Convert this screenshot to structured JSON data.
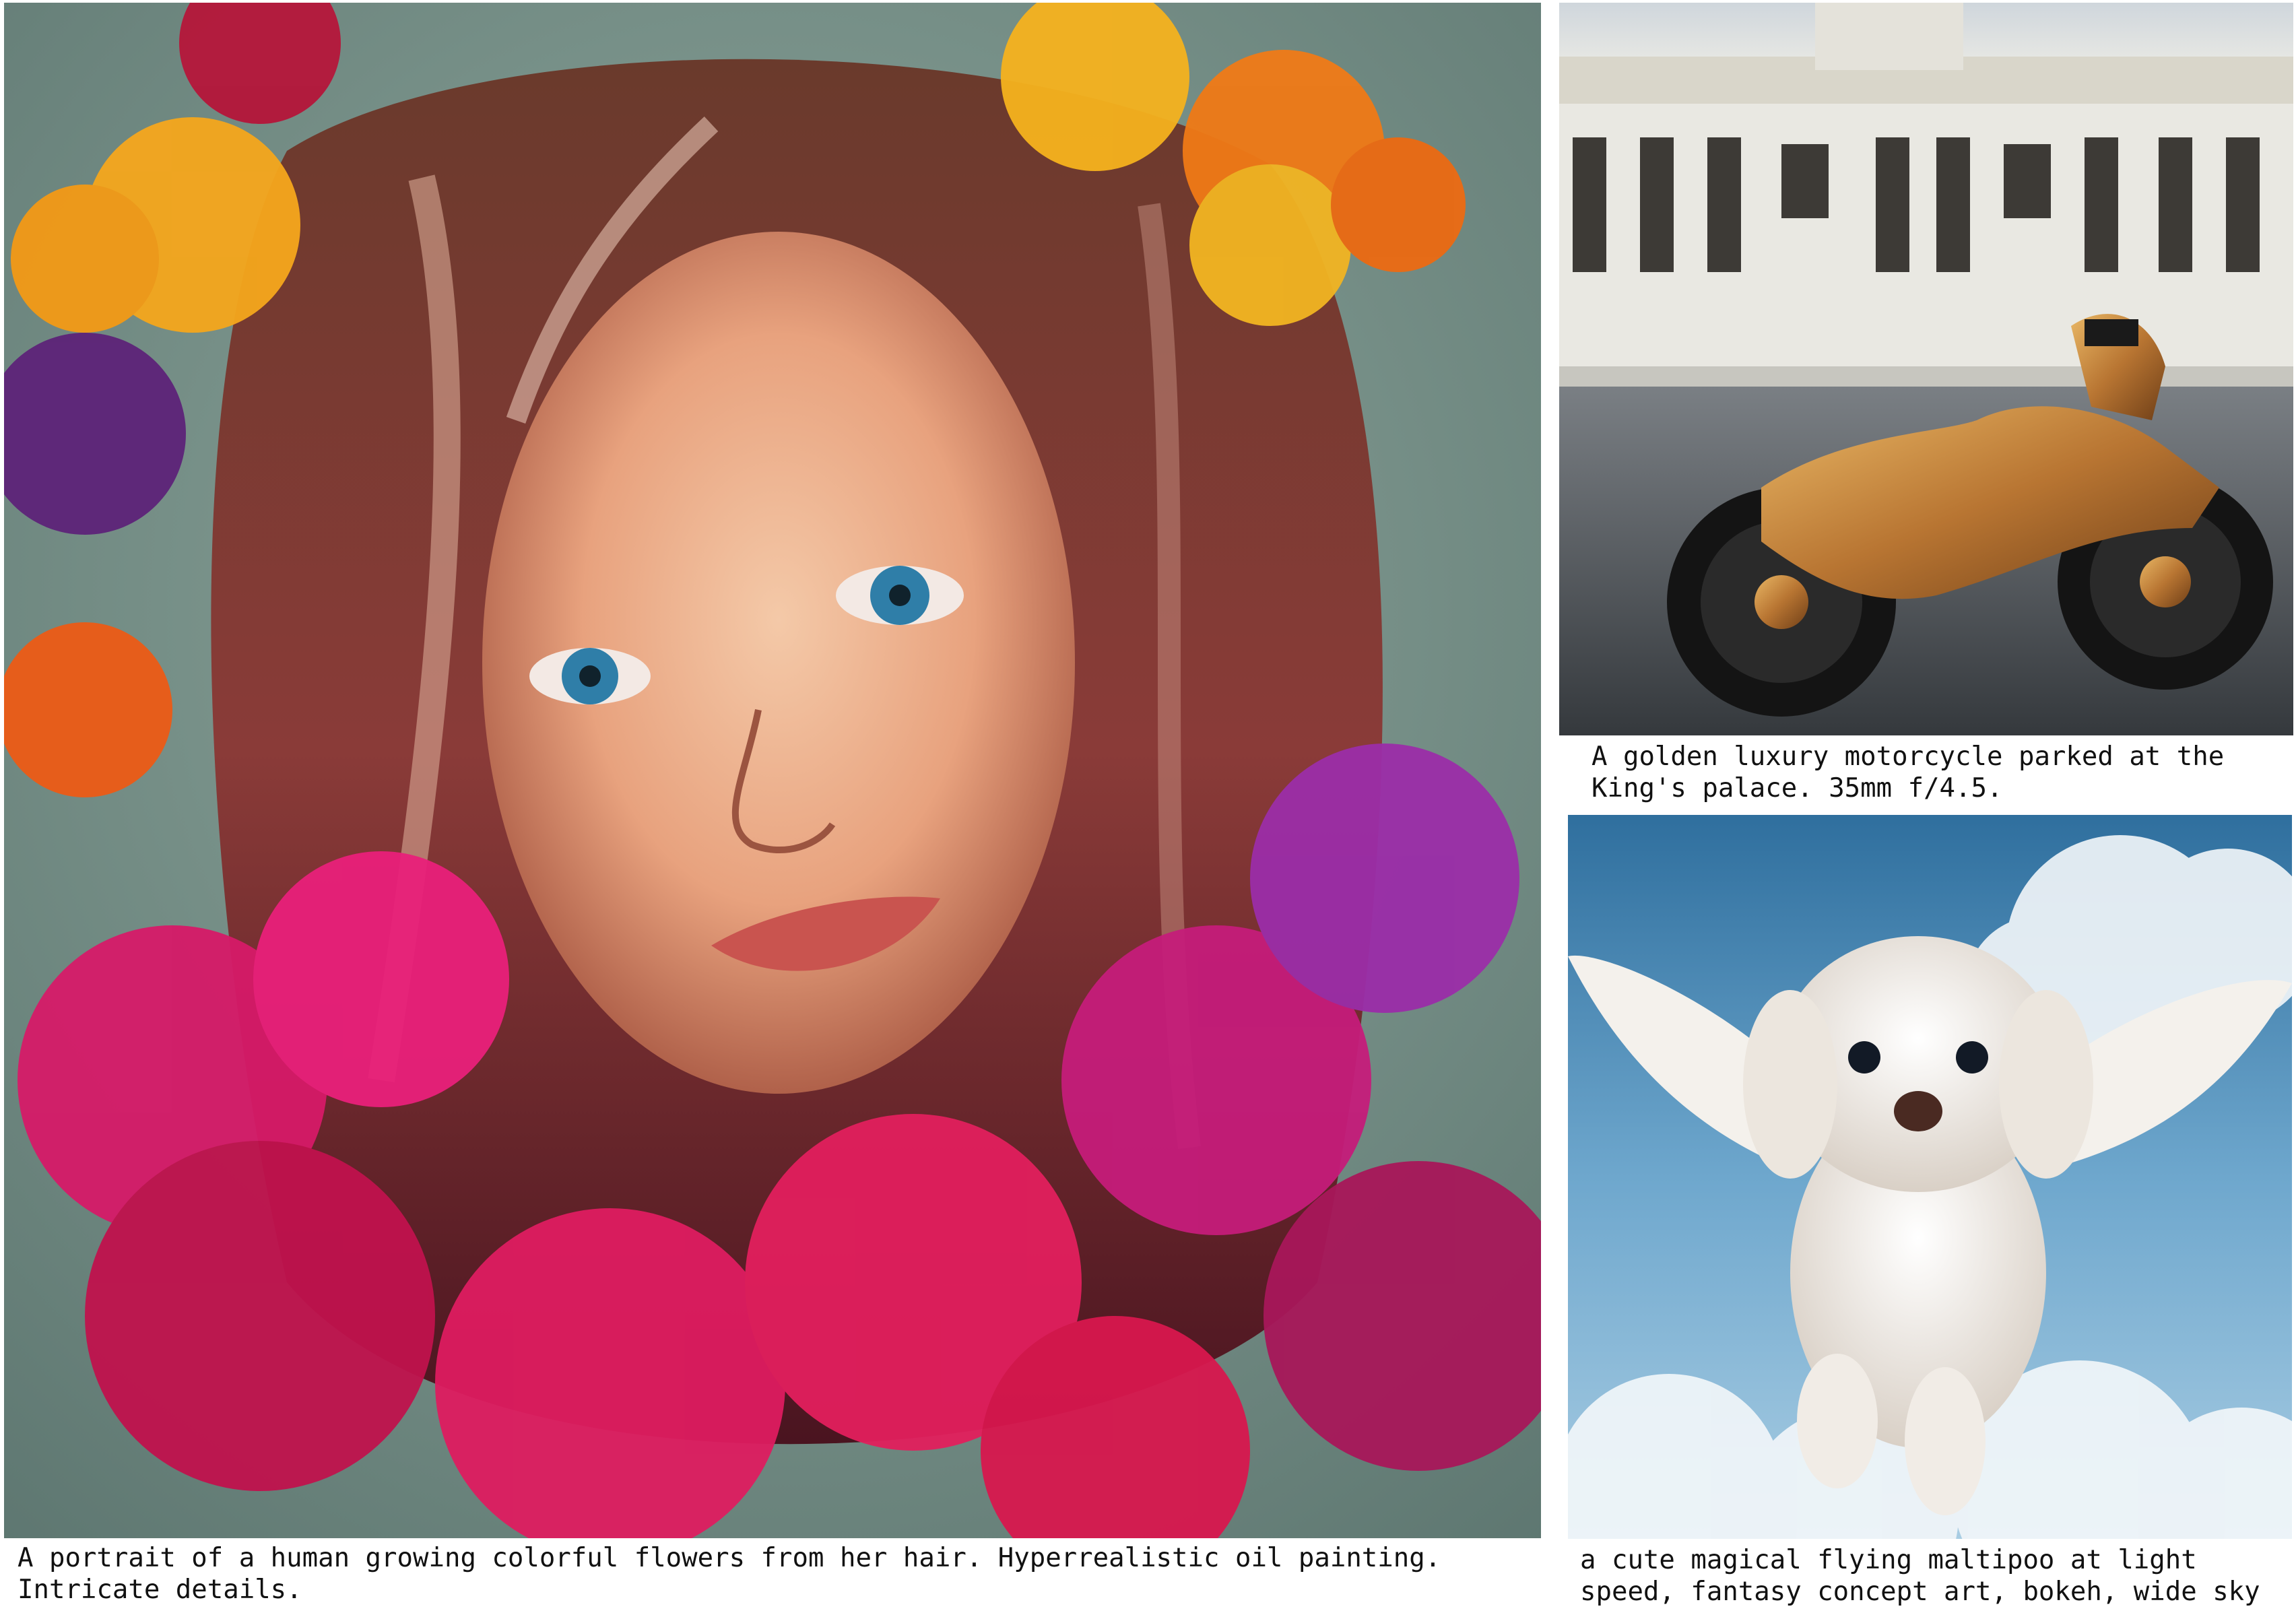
{
  "figure": {
    "panels": [
      {
        "id": "portrait",
        "caption": "A portrait of a human growing colorful flowers from her hair. Hyperrealistic oil painting. Intricate details."
      },
      {
        "id": "motorcycle",
        "caption": "A golden luxury motorcycle parked at the King's palace. 35mm f/4.5."
      },
      {
        "id": "maltipoo",
        "caption": "a cute magical flying maltipoo at light speed, fantasy concept art, bokeh, wide sky"
      }
    ]
  },
  "colors": {
    "background": "#ffffff",
    "caption_text": "#111111"
  }
}
